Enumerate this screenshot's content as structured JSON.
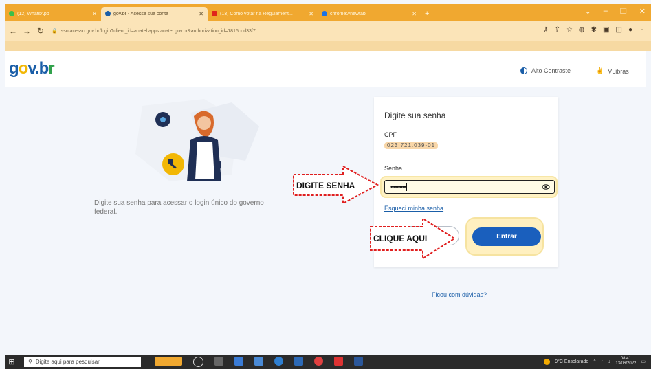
{
  "browser": {
    "tabs": [
      {
        "title": "(12) WhatsApp",
        "favicon_color": "#3bbf4a",
        "active": false
      },
      {
        "title": "gov.br - Acesse sua conta",
        "favicon_color": "#1a5ea8",
        "active": true
      },
      {
        "title": "(13) Como votar na Regulament...",
        "favicon_color": "#e0241b",
        "active": false
      },
      {
        "title": "chrome://newtab",
        "favicon_color": "#1a73e8",
        "active": false
      }
    ],
    "new_tab": "+",
    "url": "sso.acesso.gov.br/login?client_id=anatel.apps.anatel.gov.br&authorization_id=1815cdd33f7"
  },
  "header": {
    "logo": {
      "g": "g",
      "o": "o",
      "v": "v",
      "dot": ".",
      "b": "b",
      "r": "r"
    },
    "high_contrast": "Alto Contraste",
    "vlibras": "VLibras"
  },
  "intro_text": "Digite sua senha para acessar o login único do governo federal.",
  "card": {
    "title": "Digite sua senha",
    "cpf_label": "CPF",
    "cpf_value": "023.721.039-01",
    "password_label": "Senha",
    "password_value": "••••••••••",
    "forgot_link": "Esqueci minha senha",
    "enter_button": "Entrar"
  },
  "help_link": "Ficou com dúvidas?",
  "annotations": {
    "type_password": "DIGITE SENHA",
    "click_here": "CLIQUE AQUI",
    "arrow_fill": "#ffffff",
    "arrow_stroke": "#e02020"
  },
  "taskbar": {
    "search_placeholder": "Digite aqui para pesquisar",
    "weather": "9°C Ensolarado",
    "time": "08:41",
    "date": "13/06/2022"
  },
  "colors": {
    "chrome_tabstrip": "#f0a830",
    "chrome_toolbar": "#fbe4b8",
    "govbr_blue": "#1a5fbd",
    "highlight": "#fff2c4"
  }
}
